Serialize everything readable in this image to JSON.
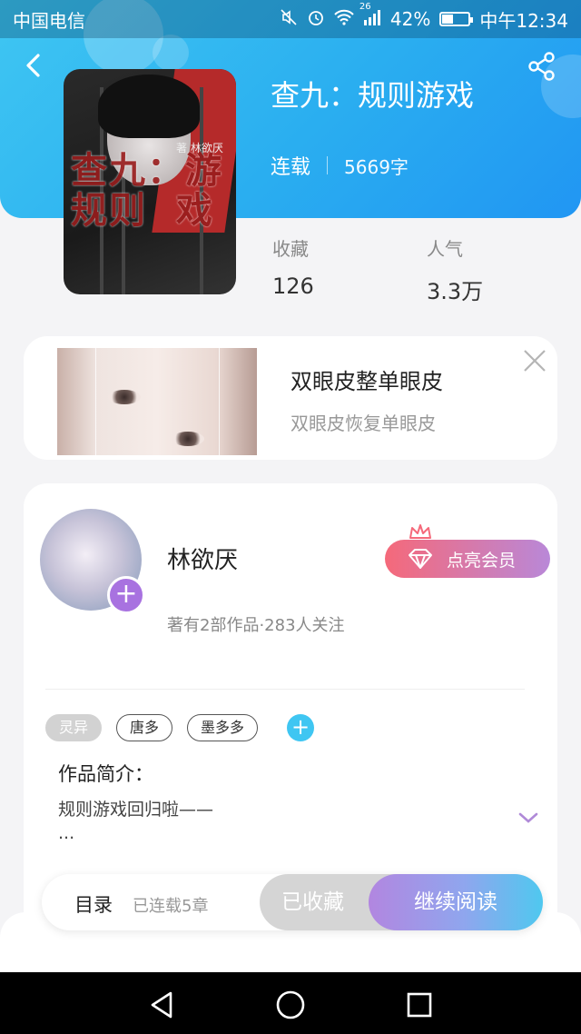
{
  "status_bar": {
    "carrier": "中国电信",
    "network": "26",
    "battery_percent": "42%",
    "battery_level": 0.42,
    "time": "中午12:34"
  },
  "book": {
    "title": "查九：规则游戏",
    "status": "连载",
    "word_count": "5669字",
    "cover_title_art": "查九：游\n规则  戏",
    "cover_author_art": "著 林欲厌"
  },
  "stats": {
    "favorites_label": "收藏",
    "favorites_value": "126",
    "popularity_label": "人气",
    "popularity_value": "3.3万"
  },
  "ad": {
    "title": "双眼皮整单眼皮",
    "subtitle": "双眼皮恢复单眼皮"
  },
  "author": {
    "name": "林欲厌",
    "stats": "著有2部作品·283人关注",
    "vip_button": "点亮会员"
  },
  "tags": [
    "灵异",
    "唐多",
    "墨多多"
  ],
  "intro": {
    "label": "作品简介：",
    "text": "规则游戏回归啦——\n..."
  },
  "bottom_bar": {
    "toc_label": "目录",
    "toc_status": "已连载5章",
    "collected_label": "已收藏",
    "read_label": "继续阅读"
  },
  "colors": {
    "header_gradient_start": "#3fc6f2",
    "header_gradient_end": "#2196f3",
    "vip_gradient_start": "#f5697a",
    "vip_gradient_end": "#b988d8",
    "read_gradient_start": "#b286e0",
    "read_gradient_end": "#4fc8ef",
    "accent_purple": "#a872e0"
  },
  "icons": {
    "back": "chevron-left-icon",
    "share": "share-icon",
    "close": "close-icon",
    "diamond": "diamond-icon",
    "crown": "crown-icon",
    "expand": "chevron-down-icon",
    "nav_back": "triangle-back-icon",
    "nav_home": "circle-home-icon",
    "nav_recent": "square-recent-icon"
  }
}
